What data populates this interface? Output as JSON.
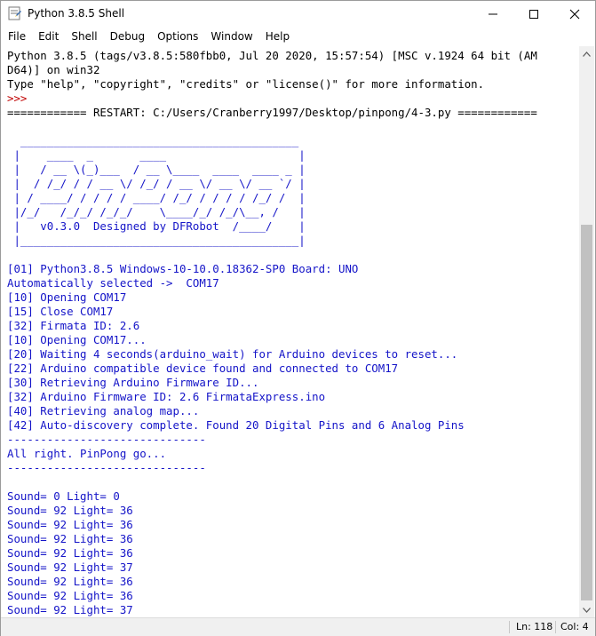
{
  "window": {
    "title": "Python 3.8.5 Shell"
  },
  "menu": [
    "File",
    "Edit",
    "Shell",
    "Debug",
    "Options",
    "Window",
    "Help"
  ],
  "shell_lines": [
    {
      "text": "Python 3.8.5 (tags/v3.8.5:580fbb0, Jul 20 2020, 15:57:54) [MSC v.1924 64 bit (AM",
      "color": "black"
    },
    {
      "text": "D64)] on win32",
      "color": "black"
    },
    {
      "text": "Type \"help\", \"copyright\", \"credits\" or \"license()\" for more information.",
      "color": "black"
    },
    {
      "text": ">>> ",
      "color": "red"
    },
    {
      "text": "============ RESTART: C:/Users/Cranberry1997/Desktop/pinpong/4-3.py ============",
      "color": "black"
    },
    {
      "text": "",
      "color": "black"
    },
    {
      "text": "  __________________________________________",
      "color": "blue"
    },
    {
      "text": " |    ____  _       ____                    |",
      "color": "blue"
    },
    {
      "text": " |   / __ \\(_)___  / __ \\____  ____  ____ _ |",
      "color": "blue"
    },
    {
      "text": " |  / /_/ / / __ \\/ /_/ / __ \\/ __ \\/ __ `/ |",
      "color": "blue"
    },
    {
      "text": " | / ____/ / / / / ____/ /_/ / / / / /_/ /  |",
      "color": "blue"
    },
    {
      "text": " |/_/   /_/_/ /_/_/    \\____/_/ /_/\\__, /   |",
      "color": "blue"
    },
    {
      "text": " |   v0.3.0  Designed by DFRobot  /____/    |",
      "color": "blue"
    },
    {
      "text": " |__________________________________________|",
      "color": "blue"
    },
    {
      "text": "",
      "color": "blue"
    },
    {
      "text": "[01] Python3.8.5 Windows-10-10.0.18362-SP0 Board: UNO",
      "color": "blue"
    },
    {
      "text": "Automatically selected ->  COM17",
      "color": "blue"
    },
    {
      "text": "[10] Opening COM17",
      "color": "blue"
    },
    {
      "text": "[15] Close COM17",
      "color": "blue"
    },
    {
      "text": "[32] Firmata ID: 2.6",
      "color": "blue"
    },
    {
      "text": "[10] Opening COM17...",
      "color": "blue"
    },
    {
      "text": "[20] Waiting 4 seconds(arduino_wait) for Arduino devices to reset...",
      "color": "blue"
    },
    {
      "text": "[22] Arduino compatible device found and connected to COM17",
      "color": "blue"
    },
    {
      "text": "[30] Retrieving Arduino Firmware ID...",
      "color": "blue"
    },
    {
      "text": "[32] Arduino Firmware ID: 2.6 FirmataExpress.ino",
      "color": "blue"
    },
    {
      "text": "[40] Retrieving analog map...",
      "color": "blue"
    },
    {
      "text": "[42] Auto-discovery complete. Found 20 Digital Pins and 6 Analog Pins",
      "color": "blue"
    },
    {
      "text": "------------------------------",
      "color": "blue"
    },
    {
      "text": "All right. PinPong go...",
      "color": "blue"
    },
    {
      "text": "------------------------------",
      "color": "blue"
    },
    {
      "text": "",
      "color": "blue"
    },
    {
      "text": "Sound= 0 Light= 0",
      "color": "blue"
    },
    {
      "text": "Sound= 92 Light= 36",
      "color": "blue"
    },
    {
      "text": "Sound= 92 Light= 36",
      "color": "blue"
    },
    {
      "text": "Sound= 92 Light= 36",
      "color": "blue"
    },
    {
      "text": "Sound= 92 Light= 36",
      "color": "blue"
    },
    {
      "text": "Sound= 92 Light= 37",
      "color": "blue"
    },
    {
      "text": "Sound= 92 Light= 36",
      "color": "blue"
    },
    {
      "text": "Sound= 92 Light= 36",
      "color": "blue"
    },
    {
      "text": "Sound= 92 Light= 37",
      "color": "blue"
    }
  ],
  "status": {
    "line": "Ln: 118",
    "col": "Col: 4"
  },
  "colors": {
    "prompt": "#c00000",
    "output": "#1414c8",
    "text": "#000000"
  },
  "icons": {
    "app": "python-idle-icon",
    "minimize": "minimize-icon",
    "maximize": "maximize-icon",
    "close": "close-icon"
  }
}
